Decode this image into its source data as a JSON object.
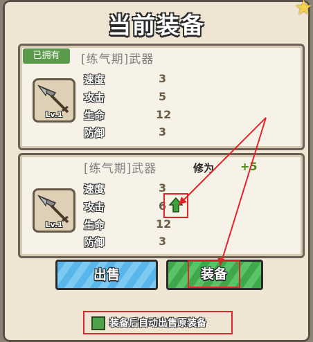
{
  "title": "当前装备",
  "current": {
    "badge": "已拥有",
    "name": "[练气期]武器",
    "level": "Lv.1",
    "stats": [
      {
        "label": "速度",
        "value": "3"
      },
      {
        "label": "攻击",
        "value": "5"
      },
      {
        "label": "生命",
        "value": "12"
      },
      {
        "label": "防御",
        "value": "3"
      }
    ]
  },
  "candidate": {
    "name": "[练气期]武器",
    "level": "Lv.1",
    "cultivation_label": "修为",
    "cultivation_value": "+5",
    "stats": [
      {
        "label": "速度",
        "value": "3"
      },
      {
        "label": "攻击",
        "value": "6"
      },
      {
        "label": "生命",
        "value": "12"
      },
      {
        "label": "防御",
        "value": "3"
      }
    ]
  },
  "buttons": {
    "sell": "出售",
    "equip": "装备"
  },
  "auto_sell": {
    "label": "装备后自动出售原装备",
    "checked": true
  },
  "icons": [
    "star-icon",
    "weapon-icon",
    "arrow-up-icon"
  ],
  "colors": {
    "accent_red": "#e0242a",
    "upgrade_green": "#3fa33a",
    "sell_blue": "#59b6ea",
    "equip_green": "#3ea84b"
  }
}
